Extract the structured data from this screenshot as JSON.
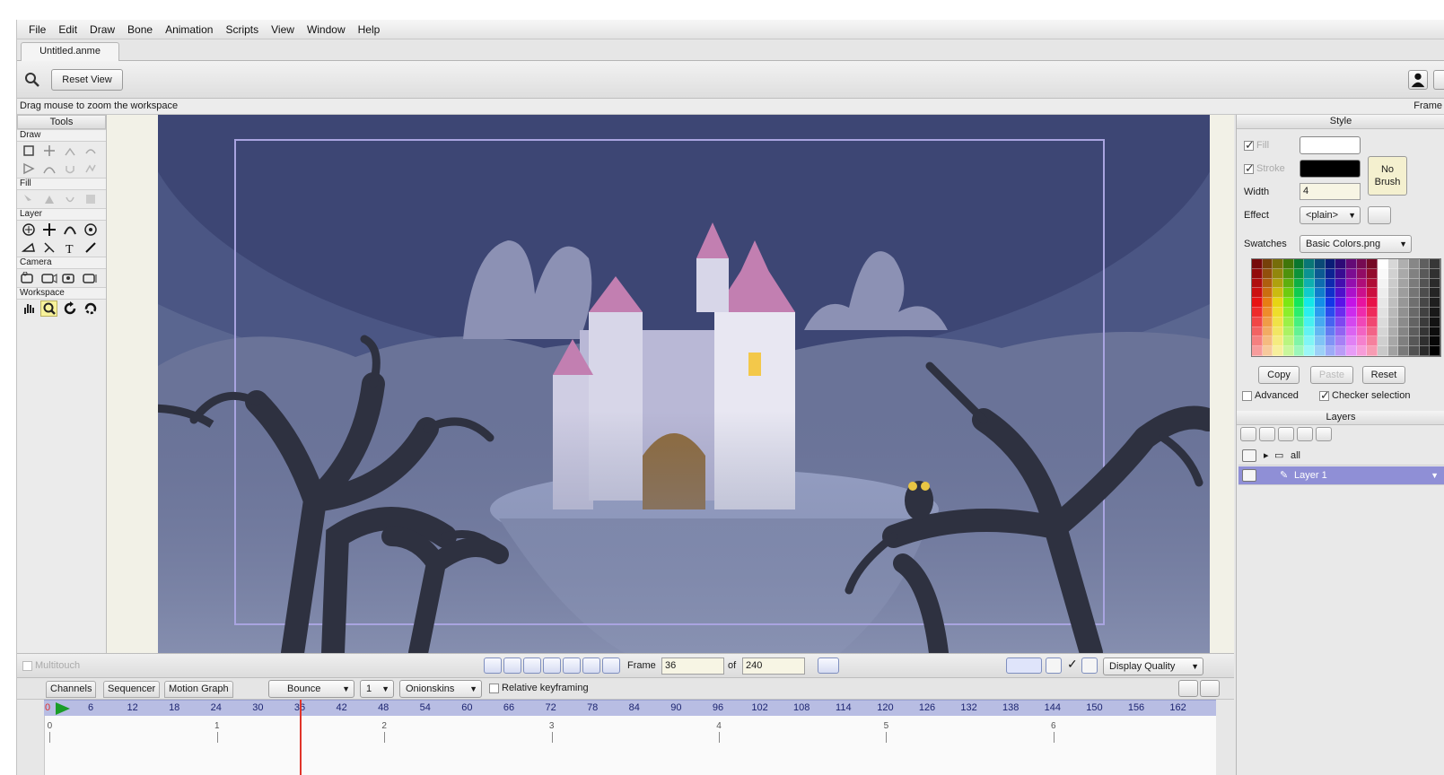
{
  "menu": [
    "File",
    "Edit",
    "Draw",
    "Bone",
    "Animation",
    "Scripts",
    "View",
    "Window",
    "Help"
  ],
  "document_tab": "Untitled.anme",
  "toolbar": {
    "reset_view": "Reset View"
  },
  "status": {
    "hint": "Drag mouse to zoom the workspace",
    "frame_label": "Frame"
  },
  "tools": {
    "title": "Tools",
    "groups": [
      "Draw",
      "Fill",
      "Layer",
      "Camera",
      "Workspace"
    ]
  },
  "style": {
    "title": "Style",
    "fill_label": "Fill",
    "stroke_label": "Stroke",
    "width_label": "Width",
    "width_value": "4",
    "effect_label": "Effect",
    "effect_value": "<plain>",
    "no_brush": "No Brush",
    "swatches_label": "Swatches",
    "swatches_value": "Basic Colors.png",
    "copy": "Copy",
    "paste": "Paste",
    "reset": "Reset",
    "advanced": "Advanced",
    "checker": "Checker selection",
    "fill_color": "#ffffff",
    "stroke_color": "#000000"
  },
  "layers": {
    "title": "Layers",
    "items": [
      {
        "name": "all",
        "type": "group"
      },
      {
        "name": "Layer 1",
        "type": "vector",
        "selected": true
      }
    ]
  },
  "playback": {
    "multitouch": "Multitouch",
    "frame_label": "Frame",
    "frame_value": "36",
    "of_label": "of",
    "total_frames": "240",
    "display_quality": "Display Quality"
  },
  "timeline": {
    "tabs": [
      "Channels",
      "Sequencer",
      "Motion Graph"
    ],
    "interpolation": "Bounce",
    "interp_count": "1",
    "onionskins": "Onionskins",
    "relative_keyframing": "Relative keyframing",
    "ruler_start": "0",
    "ruler_ticks": [
      "6",
      "12",
      "18",
      "24",
      "30",
      "36",
      "42",
      "48",
      "54",
      "60",
      "66",
      "72",
      "78",
      "84",
      "90",
      "96",
      "102",
      "108",
      "114",
      "120",
      "126",
      "132",
      "138",
      "144",
      "150",
      "156",
      "162"
    ],
    "seconds": [
      "0",
      "1",
      "2",
      "3",
      "4",
      "5",
      "6"
    ],
    "current_frame": 36
  },
  "colors": {
    "accent": "#8f8fd6",
    "playhead": "#e0342a",
    "ruler": "#b8bde3"
  }
}
